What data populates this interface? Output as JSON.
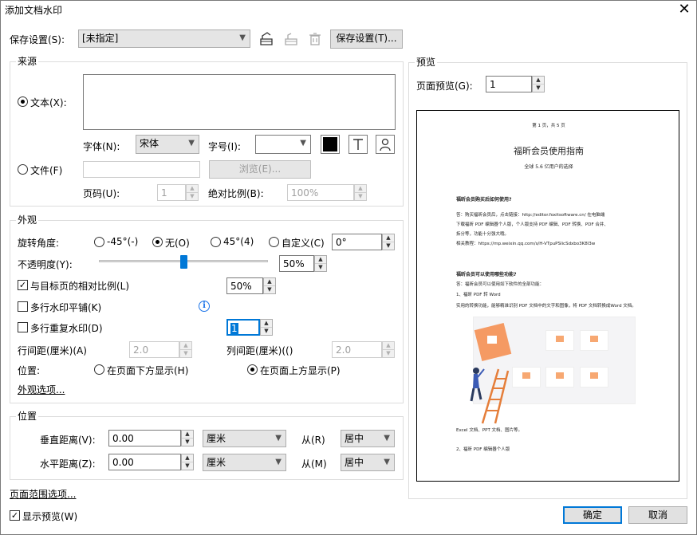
{
  "window": {
    "title": "添加文档水印",
    "close_icon": "close-icon"
  },
  "save_settings": {
    "label": "保存设置(S):",
    "value": "[未指定]",
    "button": "保存设置(T)..."
  },
  "source": {
    "group_label": "来源",
    "text_label": "文本(X):",
    "text_value": "",
    "font_label": "字体(N):",
    "font_value": "宋体",
    "size_label": "字号(I):",
    "size_value": "",
    "file_label": "文件(F)",
    "file_value": "",
    "browse_button": "浏览(E)...",
    "page_label": "页码(U):",
    "page_value": "1",
    "abs_scale_label": "绝对比例(B):",
    "abs_scale_value": "100%",
    "color": "#000000"
  },
  "appearance": {
    "group_label": "外观",
    "rotation_label": "旋转角度:",
    "rot_m45": "-45°(-)",
    "rot_none": "无(O)",
    "rot_45": "45°(4)",
    "rot_custom": "自定义(C)",
    "rot_custom_value": "0°",
    "opacity_label": "不透明度(Y):",
    "opacity_value": "50%",
    "opacity_fraction": 0.5,
    "relative_scale_label": "与目标页的相对比例(L)",
    "relative_scale_value": "50%",
    "tile_label": "多行水印平铺(K)",
    "repeat_label": "多行重复水印(D)",
    "repeat_value": "1",
    "row_spacing_label": "行间距(厘米)(A)",
    "row_spacing_value": "2.0",
    "col_spacing_label": "列间距(厘米)(()",
    "col_spacing_value": "2.0",
    "position_label": "位置:",
    "below_label": "在页面下方显示(H)",
    "above_label": "在页面上方显示(P)",
    "options_link": "外观选项..."
  },
  "position": {
    "group_label": "位置",
    "vertical_label": "垂直距离(V):",
    "vertical_value": "0.00",
    "vertical_unit": "厘米",
    "vertical_from_label": "从(R)",
    "vertical_from_value": "居中",
    "horizontal_label": "水平距离(Z):",
    "horizontal_value": "0.00",
    "horizontal_unit": "厘米",
    "horizontal_from_label": "从(M)",
    "horizontal_from_value": "居中"
  },
  "page_range_link": "页面范围选项...",
  "show_preview_label": "显示预览(W)",
  "preview": {
    "group_label": "预览",
    "page_label": "页面预览(G):",
    "page_value": "1",
    "doc": {
      "header": "第 1 页，共 5 页",
      "title": "福昕会员使用指南",
      "subtitle": "全球 5.6 亿用户的选择",
      "q1": "福昕会员购买后如何使用?",
      "a1_line1": "答：购买福昕会员后，点击链接：http://editor.foxitsoftware.cn/ 在电脑端",
      "a1_line2": "下载福昕 PDF 编辑器个人版，个人版支持 PDF 编辑、PDF 转换、PDF 合并、",
      "a1_line3": "拆分等，功能十分强大哦。",
      "a1_line4": "相关教程：https://mp.weixin.qq.com/s/H-VTpuPSlicSdxbo3K8l3w",
      "q2": "福昕会员可以使用哪些功能?",
      "a2_line1": "答：福昕会员可以使用如下软件的全部功能：",
      "a2_line2": "1、福昕 PDF 转 Word",
      "a2_line3": "实用的转换功能，能够精准识别 PDF 文档中的文字和图像，将 PDF 文档转换成Word 文档。",
      "a2_line4": "Excel 文档、PPT 文档、图片等。",
      "a2_line5": "2、福昕 PDF 编辑器个人版"
    }
  },
  "ok_button": "确定",
  "cancel_button": "取消",
  "icons": {
    "save_preset": "save-preset-icon",
    "update_preset": "update-preset-icon",
    "delete_preset": "delete-icon",
    "text_format": "text-format-icon",
    "person": "person-icon",
    "info": "info-icon"
  }
}
